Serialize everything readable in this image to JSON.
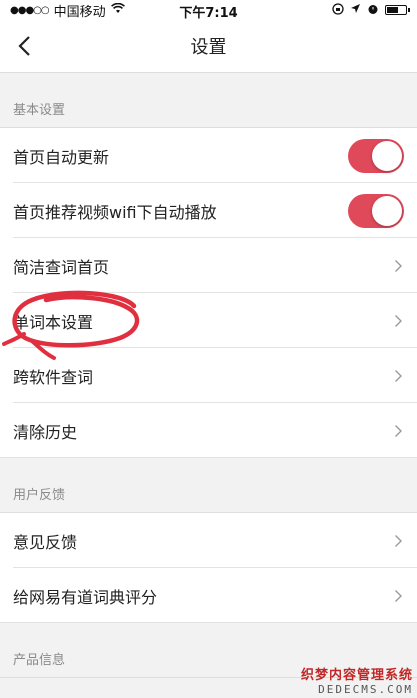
{
  "status_bar": {
    "signal": "●●●○○",
    "carrier": "中国移动",
    "time": "下午7:14"
  },
  "nav": {
    "title": "设置"
  },
  "sections": [
    {
      "header": "基本设置",
      "items": [
        {
          "label": "首页自动更新",
          "control": "toggle",
          "on": true
        },
        {
          "label": "首页推荐视频wifi下自动播放",
          "control": "toggle",
          "on": true
        },
        {
          "label": "简洁查词首页",
          "control": "chevron"
        },
        {
          "label": "单词本设置",
          "control": "chevron"
        },
        {
          "label": "跨软件查词",
          "control": "chevron"
        },
        {
          "label": "清除历史",
          "control": "chevron"
        }
      ]
    },
    {
      "header": "用户反馈",
      "items": [
        {
          "label": "意见反馈",
          "control": "chevron"
        },
        {
          "label": "给网易有道词典评分",
          "control": "chevron"
        }
      ]
    },
    {
      "header": "产品信息",
      "items": []
    }
  ],
  "colors": {
    "toggle_on": "#e0495a",
    "annotation": "#e0303f"
  },
  "watermark": {
    "line1": "织梦内容管理系统",
    "line2": "DEDECMS.COM"
  }
}
